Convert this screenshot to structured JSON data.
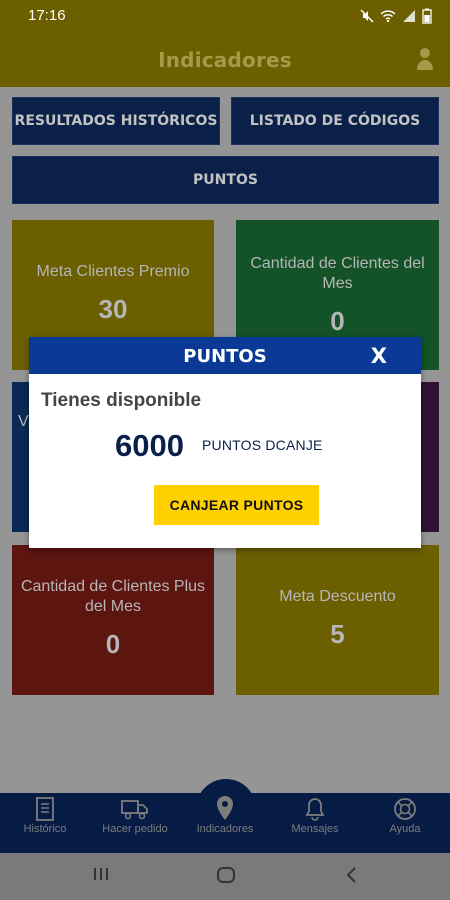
{
  "status": {
    "time": "17:16"
  },
  "appbar": {
    "title": "Indicadores"
  },
  "nav": {
    "historical": "RESULTADOS HISTÓRICOS",
    "codes": "LISTADO DE CÓDIGOS",
    "points": "PUNTOS"
  },
  "cards": [
    {
      "label": "Meta Clientes Premio",
      "value": "30"
    },
    {
      "label": "Cantidad de Clientes del Mes",
      "value": "0"
    },
    {
      "label": "V",
      "value": ""
    },
    {
      "label": "",
      "value": ""
    },
    {
      "label": "Cantidad de Clientes Plus del Mes",
      "value": "0"
    },
    {
      "label": "Meta Descuento",
      "value": "5"
    }
  ],
  "modal": {
    "title": "PUNTOS",
    "close": "X",
    "subtitle": "Tienes disponible",
    "amount": "6000",
    "unit": "PUNTOS DCANJE",
    "button": "CANJEAR PUNTOS"
  },
  "bottomnav": {
    "tabs": [
      {
        "label": "Histórico",
        "icon": "document-icon"
      },
      {
        "label": "Hacer pedido",
        "icon": "truck-icon"
      },
      {
        "label": "Indicadores",
        "icon": "location-pin-icon"
      },
      {
        "label": "Mensajes",
        "icon": "bell-icon"
      },
      {
        "label": "Ayuda",
        "icon": "lifebuoy-icon"
      }
    ]
  },
  "colors": {
    "accent_yellow": "#ffd100",
    "navy": "#0b2048",
    "modal_header": "#0b3a96"
  }
}
